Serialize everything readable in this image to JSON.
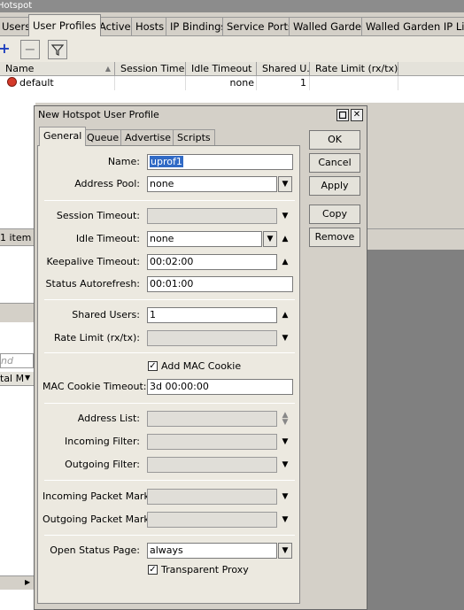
{
  "window": {
    "title": "Hotspot"
  },
  "tabs": [
    "Users",
    "User Profiles",
    "Active",
    "Hosts",
    "IP Bindings",
    "Service Ports",
    "Walled Garden",
    "Walled Garden IP List"
  ],
  "active_tab": "User Profiles",
  "table": {
    "columns": [
      "Name",
      "Session Time...",
      "Idle Timeout",
      "Shared U...",
      "Rate Limit (rx/tx)"
    ],
    "rows": [
      {
        "name": "default",
        "session_timeout": "",
        "idle_timeout": "none",
        "shared_users": "1",
        "rate_limit": ""
      }
    ]
  },
  "background_fragments": {
    "items_count": "1 item",
    "filter_placeholder": "nd",
    "column_fragment": "tal M"
  },
  "dialog": {
    "title": "New Hotspot User Profile",
    "tabs": [
      "General",
      "Queue",
      "Advertise",
      "Scripts"
    ],
    "active_tab": "General",
    "fields": {
      "name": {
        "label": "Name:",
        "value": "uprof1"
      },
      "address_pool": {
        "label": "Address Pool:",
        "value": "none"
      },
      "session_timeout": {
        "label": "Session Timeout:",
        "value": ""
      },
      "idle_timeout": {
        "label": "Idle Timeout:",
        "value": "none"
      },
      "keepalive_timeout": {
        "label": "Keepalive Timeout:",
        "value": "00:02:00"
      },
      "status_autorefresh": {
        "label": "Status Autorefresh:",
        "value": "00:01:00"
      },
      "shared_users": {
        "label": "Shared Users:",
        "value": "1"
      },
      "rate_limit": {
        "label": "Rate Limit (rx/tx):",
        "value": ""
      },
      "add_mac_cookie": {
        "label": "Add MAC Cookie",
        "checked": true
      },
      "mac_cookie_timeout": {
        "label": "MAC Cookie Timeout:",
        "value": "3d 00:00:00"
      },
      "address_list": {
        "label": "Address List:",
        "value": ""
      },
      "incoming_filter": {
        "label": "Incoming Filter:",
        "value": ""
      },
      "outgoing_filter": {
        "label": "Outgoing Filter:",
        "value": ""
      },
      "incoming_packet_mark": {
        "label": "Incoming Packet Mark:",
        "value": ""
      },
      "outgoing_packet_mark": {
        "label": "Outgoing Packet Mark:",
        "value": ""
      },
      "open_status_page": {
        "label": "Open Status Page:",
        "value": "always"
      },
      "transparent_proxy": {
        "label": "Transparent Proxy",
        "checked": true
      }
    },
    "buttons": {
      "ok": "OK",
      "cancel": "Cancel",
      "apply": "Apply",
      "copy": "Copy",
      "remove": "Remove"
    }
  },
  "icons": {
    "add": "plus-icon",
    "remove": "minus-icon",
    "filter": "funnel-icon",
    "profile": "profile-icon"
  },
  "colors": {
    "add_icon": "#1e3fbf",
    "selection": "#316ac5",
    "profile_icon": "#d43a2a"
  }
}
